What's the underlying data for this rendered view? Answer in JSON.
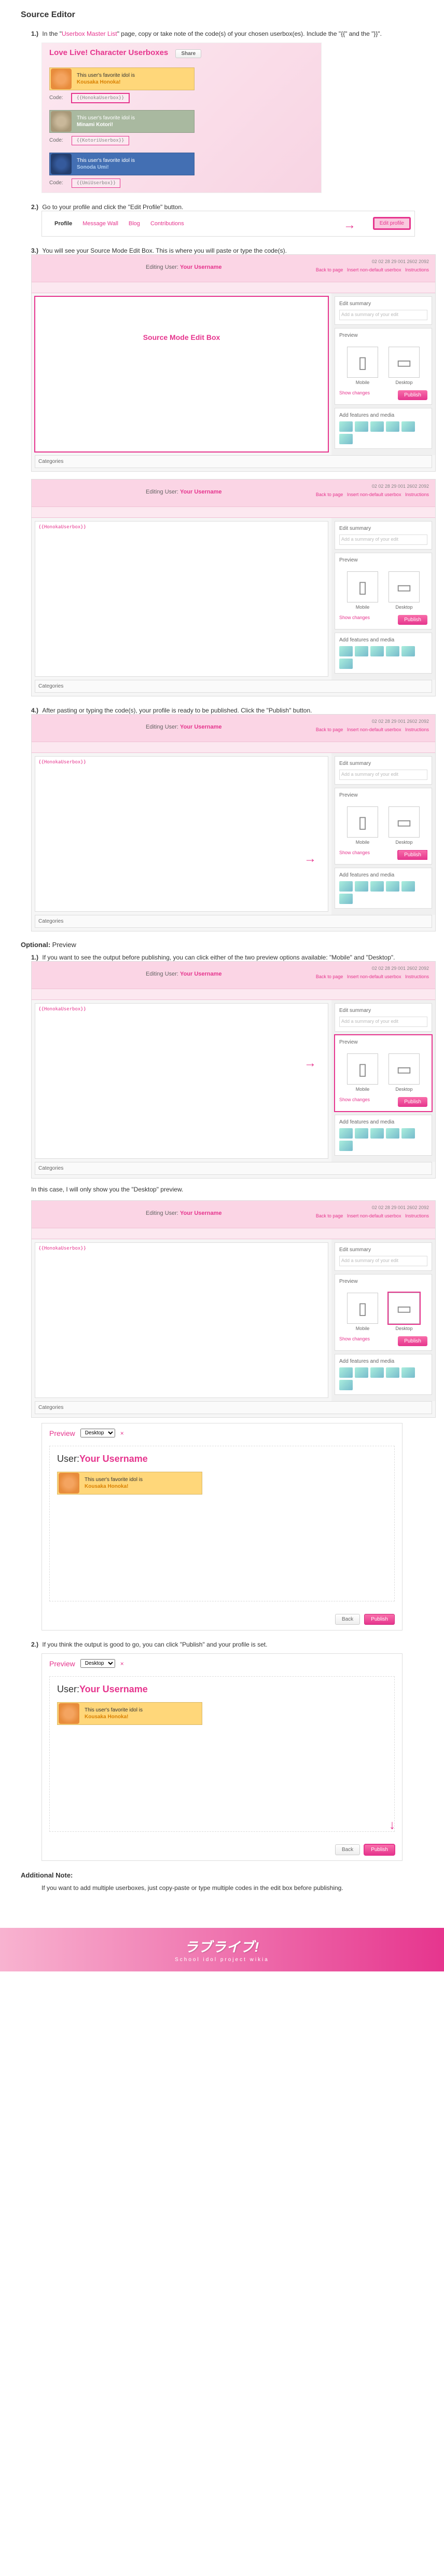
{
  "title": "Source Editor",
  "steps": {
    "s1": {
      "num": "1.)",
      "text": "In the \"Userbox Master List\" page, copy or take note of the code(s) of your chosen userbox(es). Include the \"{{\" and the \"}}\"."
    },
    "s2": {
      "num": "2.)",
      "text": "Go to your profile and click the \"Edit Profile\" button."
    },
    "s3": {
      "num": "3.)",
      "text": "You will see your Source Mode Edit Box. This is where you will paste or type the code(s)."
    },
    "s4": {
      "num": "4.)",
      "text": "After pasting or typing the code(s), your profile is ready to be published. Click the \"Publish\" button."
    }
  },
  "link_text": "Userbox Master List",
  "ss1": {
    "title": "Love Live! Character Userboxes",
    "share": "Share",
    "fav_line": "This user's favorite idol is",
    "honoka": "Kousaka Honoka!",
    "kotori": "Minami Kotori!",
    "umi": "Sonoda Umi!",
    "code_label": "Code:",
    "code_h": "{{HonokaUserbox}}",
    "code_k": "{{KotoriUserbox}}",
    "code_u": "{{UmiUserbox}}"
  },
  "tabs": {
    "profile": "Profile",
    "wall": "Message Wall",
    "blog": "Blog",
    "contrib": "Contributions",
    "edit_btn": "Edit profile"
  },
  "editor": {
    "editing": "Editing",
    "user_prefix": "User:",
    "username": "Your Username",
    "history": "02 02 28 29 001 2602 2092",
    "insert": "Insert non-default userbox",
    "edit_summary": "Edit summary",
    "summary_hint": "Add a summary of your edit",
    "preview": "Preview",
    "mobile": "Mobile",
    "desktop": "Desktop",
    "show_changes": "Show changes",
    "publish": "Publish",
    "add_features": "Add features and media",
    "categories": "Categories",
    "back_arrow": "Back to page",
    "instructions": "Instructions",
    "source_label": "Source Mode Edit Box",
    "pasted_code": "{{HonokaUserbox}}"
  },
  "optional": {
    "heading": "Optional:",
    "heading_suffix": "Preview",
    "o1": {
      "num": "1.)",
      "text": "If you want to see the output before publishing, you can click either of the two preview options available: \"Mobile\" and \"Desktop\"."
    },
    "note": "In this case, I will only show you the \"Desktop\" preview.",
    "o2": {
      "num": "2.)",
      "text": "If you think the output is good to go, you can click \"Publish\" and your profile is set."
    }
  },
  "preview": {
    "label": "Preview",
    "select": "Desktop",
    "close": "×",
    "user_prefix": "User:",
    "username": "Your Username",
    "back": "Back",
    "publish": "Publish"
  },
  "additional": {
    "heading": "Additional Note:",
    "text": "If you want to add multiple userboxes, just copy-paste or type multiple codes in the edit box before publishing."
  },
  "logo": {
    "main": "ラブライブ!",
    "sub": "School idol project wikia"
  }
}
